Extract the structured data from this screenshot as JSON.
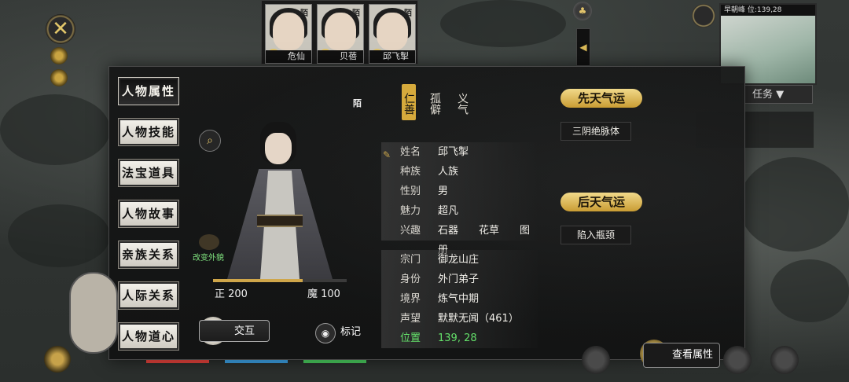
{
  "party": [
    {
      "name": "危仙",
      "mark": "陌"
    },
    {
      "name": "贝蓓",
      "mark": "陌"
    },
    {
      "name": "邱飞掣",
      "mark": "陌"
    }
  ],
  "left_tabs": [
    "人物属性",
    "人物技能",
    "法宝道具",
    "人物故事",
    "亲族关系",
    "人际关系",
    "人物道心"
  ],
  "active_tab": "人物属性",
  "character": {
    "seal": "陌",
    "outfit_label": "改变外貌",
    "zheng_label": "正 200",
    "mo_label": "魔 100",
    "alignment_fraction": 0.67
  },
  "traits": [
    "仁善",
    "孤僻",
    "义气"
  ],
  "attributes": [
    {
      "key": "姓名",
      "value": "邱飞掣"
    },
    {
      "key": "种族",
      "value": "人族"
    },
    {
      "key": "性别",
      "value": "男"
    },
    {
      "key": "魅力",
      "value": "超凡"
    },
    {
      "key": "兴趣",
      "value": "石器　　花草　　图册"
    }
  ],
  "attributes2": [
    {
      "key": "宗门",
      "value": "御龙山庄"
    },
    {
      "key": "身份",
      "value": "外门弟子"
    },
    {
      "key": "境界",
      "value": "炼气中期"
    },
    {
      "key": "声望",
      "value": "默默无闻（461）"
    },
    {
      "key": "位置",
      "value": "139, 28"
    }
  ],
  "innate_fortune": {
    "title": "先天气运",
    "value": "三阴绝脉体"
  },
  "acquired_fortune": {
    "title": "后天气运",
    "value": "陷入瓶颈"
  },
  "buttons": {
    "interact": "交互",
    "mark": "标记",
    "view_attributes": "查看属性"
  },
  "hud": {
    "task": "任务 ▼",
    "minimap_header": "早朝峰 位:139,28"
  },
  "colors": {
    "gold": "#d6aa3c",
    "green_text": "#64e06a"
  }
}
